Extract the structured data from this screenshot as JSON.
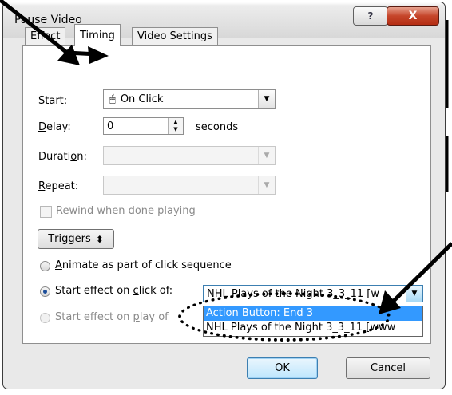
{
  "window": {
    "title": "Pause Video",
    "help_label": "?",
    "close_label": "X"
  },
  "tabs": [
    {
      "label": "Effect",
      "active": false
    },
    {
      "label": "Timing",
      "active": true
    },
    {
      "label": "Video Settings",
      "active": false
    }
  ],
  "fields": {
    "start": {
      "label_key": "S",
      "label_rest": "tart:",
      "value": "On Click",
      "icon": "mouse-click-icon"
    },
    "delay": {
      "label_key": "D",
      "label_rest": "elay:",
      "value": "0",
      "unit": "seconds"
    },
    "duration": {
      "label_pre": "Durati",
      "label_key": "o",
      "label_rest": "n:",
      "value": ""
    },
    "repeat": {
      "label_key": "R",
      "label_rest": "epeat:",
      "value": ""
    }
  },
  "rewind": {
    "label_pre": "Re",
    "label_key": "w",
    "label_rest": "ind when done playing",
    "checked": false
  },
  "triggers_button": {
    "label_key": "T",
    "label_rest": "riggers",
    "glyph": "⬍"
  },
  "options": {
    "animate": {
      "label_key": "A",
      "label_rest": "nimate as part of click sequence",
      "selected": false
    },
    "start_on_click": {
      "label_pre": "Start effect on ",
      "label_key": "c",
      "label_rest": "lick of:",
      "selected": true,
      "value": "NHL Plays of the Night 3_3_11 [w"
    },
    "start_on_play": {
      "label_pre": "Start effect on ",
      "label_key": "p",
      "label_rest": "lay of",
      "selected": false
    }
  },
  "dropdown_list": {
    "items": [
      {
        "label": "Action Button: End 3",
        "highlighted": true
      },
      {
        "label": "NHL Plays of the Night 3_3_11 [www",
        "highlighted": false
      }
    ]
  },
  "buttons": {
    "ok_label": "OK",
    "cancel_label": "Cancel"
  },
  "colors": {
    "highlight": "#3399ff",
    "close_button": "#c5452a"
  }
}
